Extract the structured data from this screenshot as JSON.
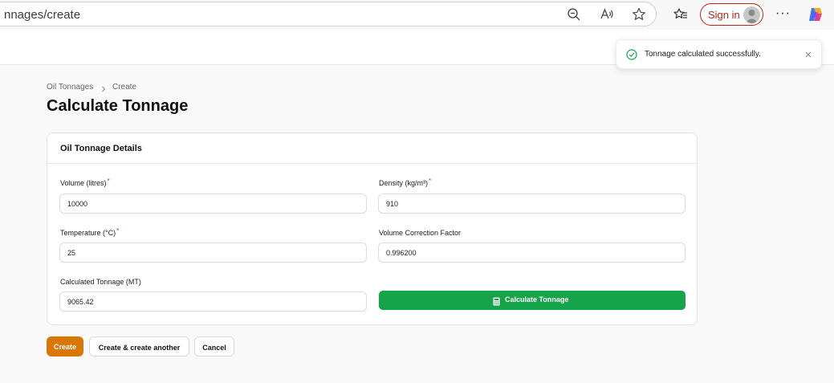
{
  "browser": {
    "url": "nnages/create",
    "signin_label": "Sign in",
    "more_label": "···"
  },
  "toast": {
    "message": "Tonnage calculated successfully.",
    "status_color": "#16a34a"
  },
  "breadcrumb": {
    "parent": "Oil Tonnages",
    "current": "Create"
  },
  "page": {
    "title": "Calculate Tonnage"
  },
  "form": {
    "section_title": "Oil Tonnage Details",
    "volume": {
      "label": "Volume (litres)",
      "required": "*",
      "value": "10000"
    },
    "density": {
      "label": "Density (kg/m³)",
      "required": "*",
      "value": "910"
    },
    "temperature": {
      "label": "Temperature (°C)",
      "required": "*",
      "value": "25"
    },
    "vcf": {
      "label": "Volume Correction Factor",
      "value": "0.996200"
    },
    "tonnage": {
      "label": "Calculated Tonnage (MT)",
      "value": "9065.42"
    },
    "calculate_label": "Calculate Tonnage"
  },
  "actions": {
    "create": "Create",
    "create_another": "Create & create another",
    "cancel": "Cancel"
  },
  "colors": {
    "primary_action": "#d97706",
    "success_button": "#16a34a",
    "required_marker": "#d92d20"
  }
}
